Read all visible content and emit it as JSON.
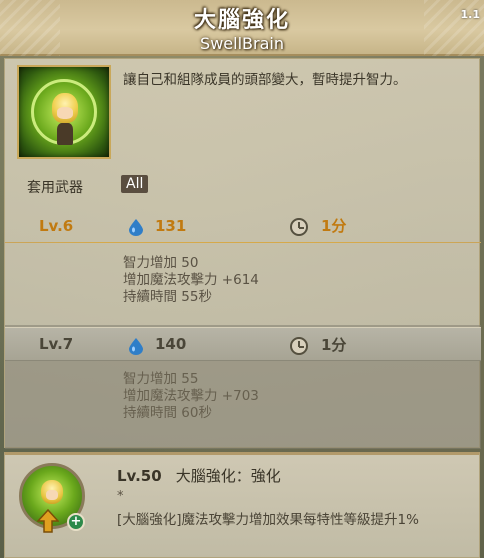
{
  "header": {
    "title": "大腦強化",
    "subtitle": "SwellBrain",
    "corner_badge": "1.1"
  },
  "skill": {
    "description": "讓自己和組隊成員的頭部變大，暫時提升智力。",
    "weapon_label": "套用武器",
    "weapon_value": "All"
  },
  "levels": [
    {
      "level": "Lv.6",
      "mp": "131",
      "cooldown": "1分",
      "effects": [
        "智力增加 50",
        "增加魔法攻擊力 +614",
        "持續時間 55秒"
      ]
    },
    {
      "level": "Lv.7",
      "mp": "140",
      "cooldown": "1分",
      "effects": [
        "智力增加 55",
        "增加魔法攻擊力 +703",
        "持續時間 60秒"
      ]
    }
  ],
  "enhancement": {
    "level": "Lv.50",
    "name": "大腦強化：強化",
    "star": "*",
    "description": "[大腦強化]魔法攻擊力增加效果每特性等級提升1%"
  },
  "icons": {
    "mp": "water-drop-icon",
    "cooldown": "clock-icon",
    "skill": "swellbrain-skill-icon",
    "upgrade": "up-arrow-icon",
    "plus": "plus-badge-icon"
  }
}
